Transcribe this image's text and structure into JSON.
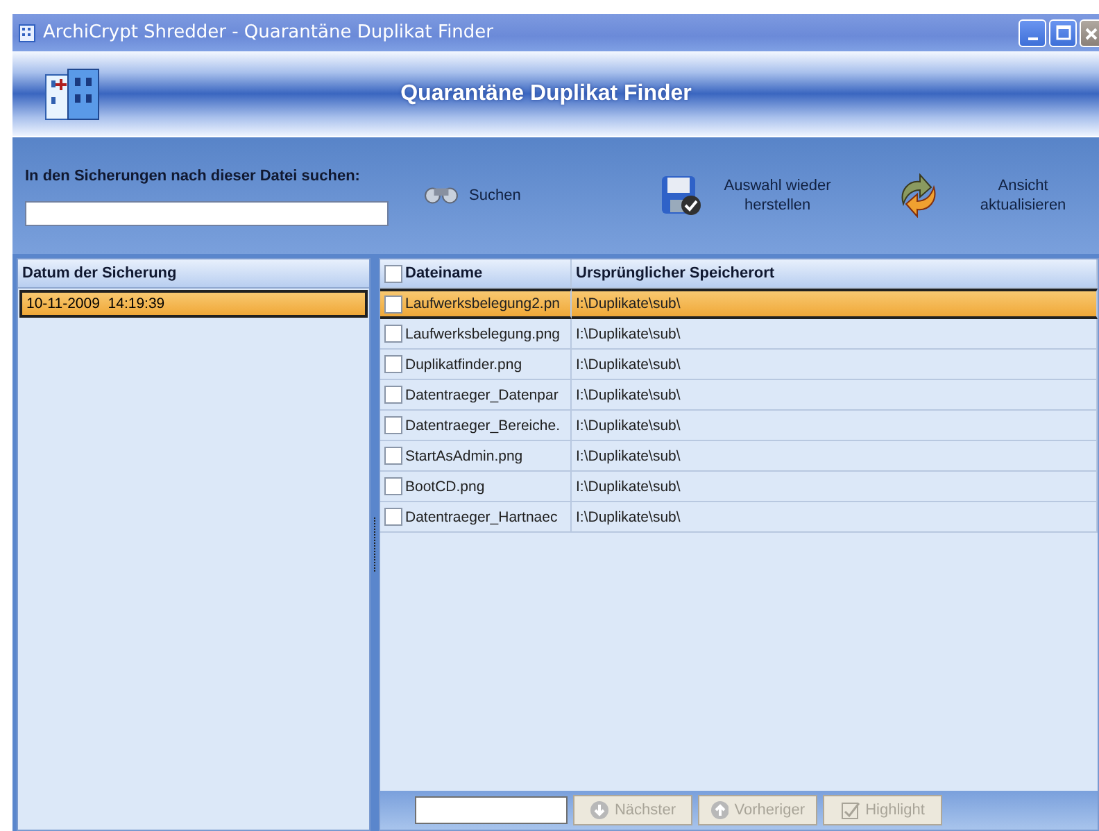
{
  "window": {
    "title": "ArchiCrypt Shredder - Quarantäne Duplikat Finder"
  },
  "banner": {
    "title": "Quarantäne Duplikat Finder"
  },
  "search": {
    "label": "In den Sicherungen nach dieser Datei suchen:"
  },
  "toolbar": [
    {
      "kind": "search",
      "label": "Suchen"
    },
    {
      "kind": "restore",
      "label": "Auswahl wieder herstellen"
    },
    {
      "kind": "refresh",
      "label": "Ansicht aktualisieren"
    }
  ],
  "backups": {
    "column": "Datum der Sicherung",
    "items": [
      {
        "date": "10-11-2009  14:19:39",
        "selected": true
      }
    ]
  },
  "files": {
    "columns": [
      "Dateiname",
      "Ursprünglicher Speicherort"
    ],
    "all_checked": false,
    "rows": [
      {
        "name": "Laufwerksbelegung2.pn",
        "location": "I:\\Duplikate\\sub\\",
        "checked": false,
        "selected": true
      },
      {
        "name": "Laufwerksbelegung.png",
        "location": "I:\\Duplikate\\sub\\",
        "checked": false,
        "selected": false
      },
      {
        "name": "Duplikatfinder.png",
        "location": "I:\\Duplikate\\sub\\",
        "checked": false,
        "selected": false
      },
      {
        "name": "Datentraeger_Datenpar",
        "location": "I:\\Duplikate\\sub\\",
        "checked": false,
        "selected": false
      },
      {
        "name": "Datentraeger_Bereiche.",
        "location": "I:\\Duplikate\\sub\\",
        "checked": false,
        "selected": false
      },
      {
        "name": "StartAsAdmin.png",
        "location": "I:\\Duplikate\\sub\\",
        "checked": false,
        "selected": false
      },
      {
        "name": "BootCD.png",
        "location": "I:\\Duplikate\\sub\\",
        "checked": false,
        "selected": false
      },
      {
        "name": "Datentraeger_Hartnaec",
        "location": "I:\\Duplikate\\sub\\",
        "checked": false,
        "selected": false
      }
    ]
  },
  "find_bar": {
    "buttons": [
      {
        "kind": "next",
        "label": "Nächster",
        "disabled": true
      },
      {
        "kind": "prev",
        "label": "Vorheriger",
        "disabled": true
      },
      {
        "kind": "highlight",
        "label": "Highlight",
        "disabled": true
      }
    ]
  }
}
